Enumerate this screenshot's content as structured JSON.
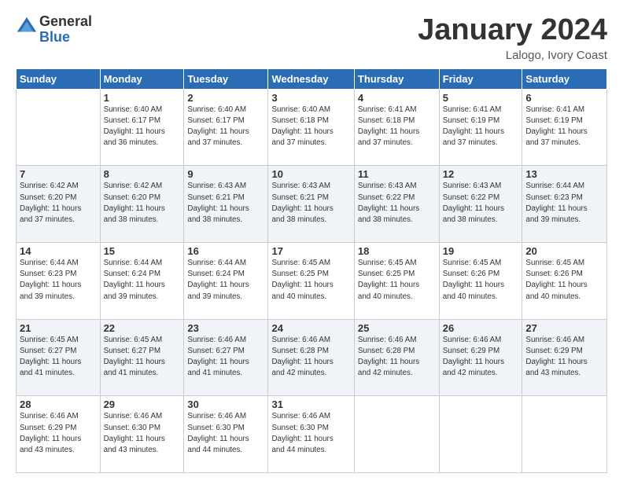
{
  "logo": {
    "general": "General",
    "blue": "Blue"
  },
  "header": {
    "title": "January 2024",
    "location": "Lalogo, Ivory Coast"
  },
  "weekdays": [
    "Sunday",
    "Monday",
    "Tuesday",
    "Wednesday",
    "Thursday",
    "Friday",
    "Saturday"
  ],
  "weeks": [
    [
      {
        "day": "",
        "info": ""
      },
      {
        "day": "1",
        "info": "Sunrise: 6:40 AM\nSunset: 6:17 PM\nDaylight: 11 hours\nand 36 minutes."
      },
      {
        "day": "2",
        "info": "Sunrise: 6:40 AM\nSunset: 6:17 PM\nDaylight: 11 hours\nand 37 minutes."
      },
      {
        "day": "3",
        "info": "Sunrise: 6:40 AM\nSunset: 6:18 PM\nDaylight: 11 hours\nand 37 minutes."
      },
      {
        "day": "4",
        "info": "Sunrise: 6:41 AM\nSunset: 6:18 PM\nDaylight: 11 hours\nand 37 minutes."
      },
      {
        "day": "5",
        "info": "Sunrise: 6:41 AM\nSunset: 6:19 PM\nDaylight: 11 hours\nand 37 minutes."
      },
      {
        "day": "6",
        "info": "Sunrise: 6:41 AM\nSunset: 6:19 PM\nDaylight: 11 hours\nand 37 minutes."
      }
    ],
    [
      {
        "day": "7",
        "info": "Sunrise: 6:42 AM\nSunset: 6:20 PM\nDaylight: 11 hours\nand 37 minutes."
      },
      {
        "day": "8",
        "info": "Sunrise: 6:42 AM\nSunset: 6:20 PM\nDaylight: 11 hours\nand 38 minutes."
      },
      {
        "day": "9",
        "info": "Sunrise: 6:43 AM\nSunset: 6:21 PM\nDaylight: 11 hours\nand 38 minutes."
      },
      {
        "day": "10",
        "info": "Sunrise: 6:43 AM\nSunset: 6:21 PM\nDaylight: 11 hours\nand 38 minutes."
      },
      {
        "day": "11",
        "info": "Sunrise: 6:43 AM\nSunset: 6:22 PM\nDaylight: 11 hours\nand 38 minutes."
      },
      {
        "day": "12",
        "info": "Sunrise: 6:43 AM\nSunset: 6:22 PM\nDaylight: 11 hours\nand 38 minutes."
      },
      {
        "day": "13",
        "info": "Sunrise: 6:44 AM\nSunset: 6:23 PM\nDaylight: 11 hours\nand 39 minutes."
      }
    ],
    [
      {
        "day": "14",
        "info": "Sunrise: 6:44 AM\nSunset: 6:23 PM\nDaylight: 11 hours\nand 39 minutes."
      },
      {
        "day": "15",
        "info": "Sunrise: 6:44 AM\nSunset: 6:24 PM\nDaylight: 11 hours\nand 39 minutes."
      },
      {
        "day": "16",
        "info": "Sunrise: 6:44 AM\nSunset: 6:24 PM\nDaylight: 11 hours\nand 39 minutes."
      },
      {
        "day": "17",
        "info": "Sunrise: 6:45 AM\nSunset: 6:25 PM\nDaylight: 11 hours\nand 40 minutes."
      },
      {
        "day": "18",
        "info": "Sunrise: 6:45 AM\nSunset: 6:25 PM\nDaylight: 11 hours\nand 40 minutes."
      },
      {
        "day": "19",
        "info": "Sunrise: 6:45 AM\nSunset: 6:26 PM\nDaylight: 11 hours\nand 40 minutes."
      },
      {
        "day": "20",
        "info": "Sunrise: 6:45 AM\nSunset: 6:26 PM\nDaylight: 11 hours\nand 40 minutes."
      }
    ],
    [
      {
        "day": "21",
        "info": "Sunrise: 6:45 AM\nSunset: 6:27 PM\nDaylight: 11 hours\nand 41 minutes."
      },
      {
        "day": "22",
        "info": "Sunrise: 6:45 AM\nSunset: 6:27 PM\nDaylight: 11 hours\nand 41 minutes."
      },
      {
        "day": "23",
        "info": "Sunrise: 6:46 AM\nSunset: 6:27 PM\nDaylight: 11 hours\nand 41 minutes."
      },
      {
        "day": "24",
        "info": "Sunrise: 6:46 AM\nSunset: 6:28 PM\nDaylight: 11 hours\nand 42 minutes."
      },
      {
        "day": "25",
        "info": "Sunrise: 6:46 AM\nSunset: 6:28 PM\nDaylight: 11 hours\nand 42 minutes."
      },
      {
        "day": "26",
        "info": "Sunrise: 6:46 AM\nSunset: 6:29 PM\nDaylight: 11 hours\nand 42 minutes."
      },
      {
        "day": "27",
        "info": "Sunrise: 6:46 AM\nSunset: 6:29 PM\nDaylight: 11 hours\nand 43 minutes."
      }
    ],
    [
      {
        "day": "28",
        "info": "Sunrise: 6:46 AM\nSunset: 6:29 PM\nDaylight: 11 hours\nand 43 minutes."
      },
      {
        "day": "29",
        "info": "Sunrise: 6:46 AM\nSunset: 6:30 PM\nDaylight: 11 hours\nand 43 minutes."
      },
      {
        "day": "30",
        "info": "Sunrise: 6:46 AM\nSunset: 6:30 PM\nDaylight: 11 hours\nand 44 minutes."
      },
      {
        "day": "31",
        "info": "Sunrise: 6:46 AM\nSunset: 6:30 PM\nDaylight: 11 hours\nand 44 minutes."
      },
      {
        "day": "",
        "info": ""
      },
      {
        "day": "",
        "info": ""
      },
      {
        "day": "",
        "info": ""
      }
    ]
  ]
}
